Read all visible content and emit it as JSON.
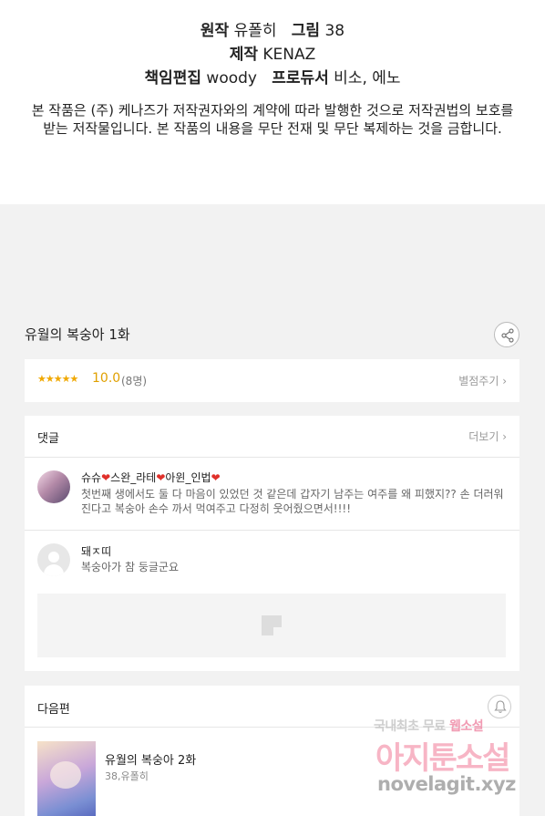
{
  "credits": {
    "original_label": "원작",
    "original_value": "유폴히",
    "art_label": "그림",
    "art_value": "38",
    "production_label": "제작",
    "production_value": "KENAZ",
    "editor_label": "책임편집",
    "editor_value": "woody",
    "producer_label": "프로듀서",
    "producer_value": "비소, 에노",
    "notice_line1": "본 작품은 (주) 케나즈가 저작권자와의 계약에 따라 발행한 것으로 저작권법의 보호를",
    "notice_line2": "받는 저작물입니다. 본 작품의 내용을 무단 전재 및 무단 복제하는 것을 금합니다."
  },
  "episode": {
    "title": "유월의 복숭아 1화",
    "share_icon": "share-icon"
  },
  "rating": {
    "stars": "★★★★★",
    "score": "10.0",
    "count": "(8명)",
    "rate_link": "별점주기 ›"
  },
  "comments": {
    "header": "댓글",
    "more_link": "더보기 ›",
    "items": [
      {
        "nick_parts": [
          "슈슈",
          "스완_라테",
          "아윈_인법"
        ],
        "heart": "❤",
        "text": "첫번째 생에서도 둘 다 마음이 있었던 것 같은데 갑자기 남주는 여주를 왜 피했지?? 손 더러워진다고 복숭아 손수 까서 먹여주고 다정히 웃어줬으면서!!!!"
      },
      {
        "nick": "돼ㅈ띠",
        "text": "복숭아가 참 둥글군요"
      }
    ]
  },
  "next": {
    "header": "다음편",
    "bell_icon": "bell-icon",
    "title": "유월의 복숭아 2화",
    "author": "38,유폴히"
  },
  "watermark": {
    "line1_a": "국내최초 무료",
    "line1_b": "웹소설",
    "line2": "아지툰소설",
    "line3": "novelagit.xyz"
  },
  "colors": {
    "star": "#f0a800",
    "heart": "#e0302a",
    "background": "#f2f2f2"
  }
}
